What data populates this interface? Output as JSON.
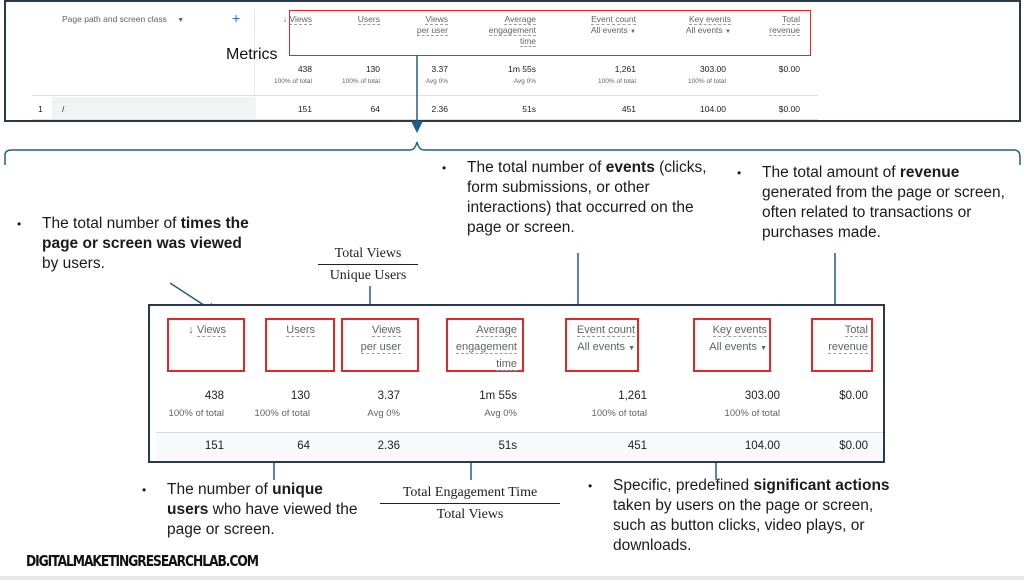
{
  "top_table": {
    "dimension_label": "Page path and screen class",
    "dimension_dropdown_icon": "caret-down-icon",
    "add_dimension_icon": "plus-icon",
    "sort_icon": "arrow-down-icon",
    "metrics_label": "Metrics",
    "columns": [
      {
        "line1": "Views",
        "line2": "",
        "line3": "",
        "sorted": true
      },
      {
        "line1": "Users",
        "line2": "",
        "line3": ""
      },
      {
        "line1": "Views",
        "line2": "per user",
        "line3": ""
      },
      {
        "line1": "Average",
        "line2": "engagement",
        "line3": "time"
      },
      {
        "line1": "Event count",
        "line2": "All events",
        "line3": "",
        "dropdown": true
      },
      {
        "line1": "Key events",
        "line2": "All events",
        "line3": "",
        "dropdown": true
      },
      {
        "line1": "Total",
        "line2": "revenue",
        "line3": ""
      }
    ],
    "totals": [
      {
        "value": "438",
        "sub": "100% of total"
      },
      {
        "value": "130",
        "sub": "100% of total"
      },
      {
        "value": "3.37",
        "sub": "Avg 0%"
      },
      {
        "value": "1m 55s",
        "sub": "Avg 0%"
      },
      {
        "value": "1,261",
        "sub": "100% of total"
      },
      {
        "value": "303.00",
        "sub": "100% of total"
      },
      {
        "value": "$0.00",
        "sub": ""
      }
    ],
    "rows": [
      {
        "index": "1",
        "path": "/",
        "values": [
          "151",
          "64",
          "2.36",
          "51s",
          "451",
          "104.00",
          "$0.00"
        ]
      }
    ]
  },
  "annotations": {
    "views": {
      "pre": "The total number of ",
      "bold": "times the page or screen was viewed",
      "post": " by users."
    },
    "views_per_user_formula": {
      "numerator": "Total Views",
      "denominator": "Unique Users"
    },
    "event_count": {
      "pre": "The total number of ",
      "bold": "events",
      "post": " (clicks, form submissions, or other interactions) that occurred on the page or screen."
    },
    "total_revenue": {
      "pre": "The total amount of ",
      "bold": "revenue",
      "post": " generated from the page or screen, often related to transactions or purchases made."
    },
    "users": {
      "pre": "The number of ",
      "bold": "unique users",
      "post": " who have viewed the page or screen."
    },
    "engagement_formula": {
      "numerator": "Total Engagement Time",
      "denominator": "Total Views"
    },
    "key_events": {
      "pre": "Specific, predefined ",
      "bold": "significant actions",
      "post": " taken by users on the page or screen, such as button clicks, video plays, or downloads."
    },
    "bullet": "•"
  },
  "footer": {
    "brand": "DIGITALMAKETINGRESEARCHLAB.COM"
  },
  "colors": {
    "highlight_box": "#e3262a",
    "connector": "#1f5f86",
    "panel_border": "#2b3a4a"
  }
}
